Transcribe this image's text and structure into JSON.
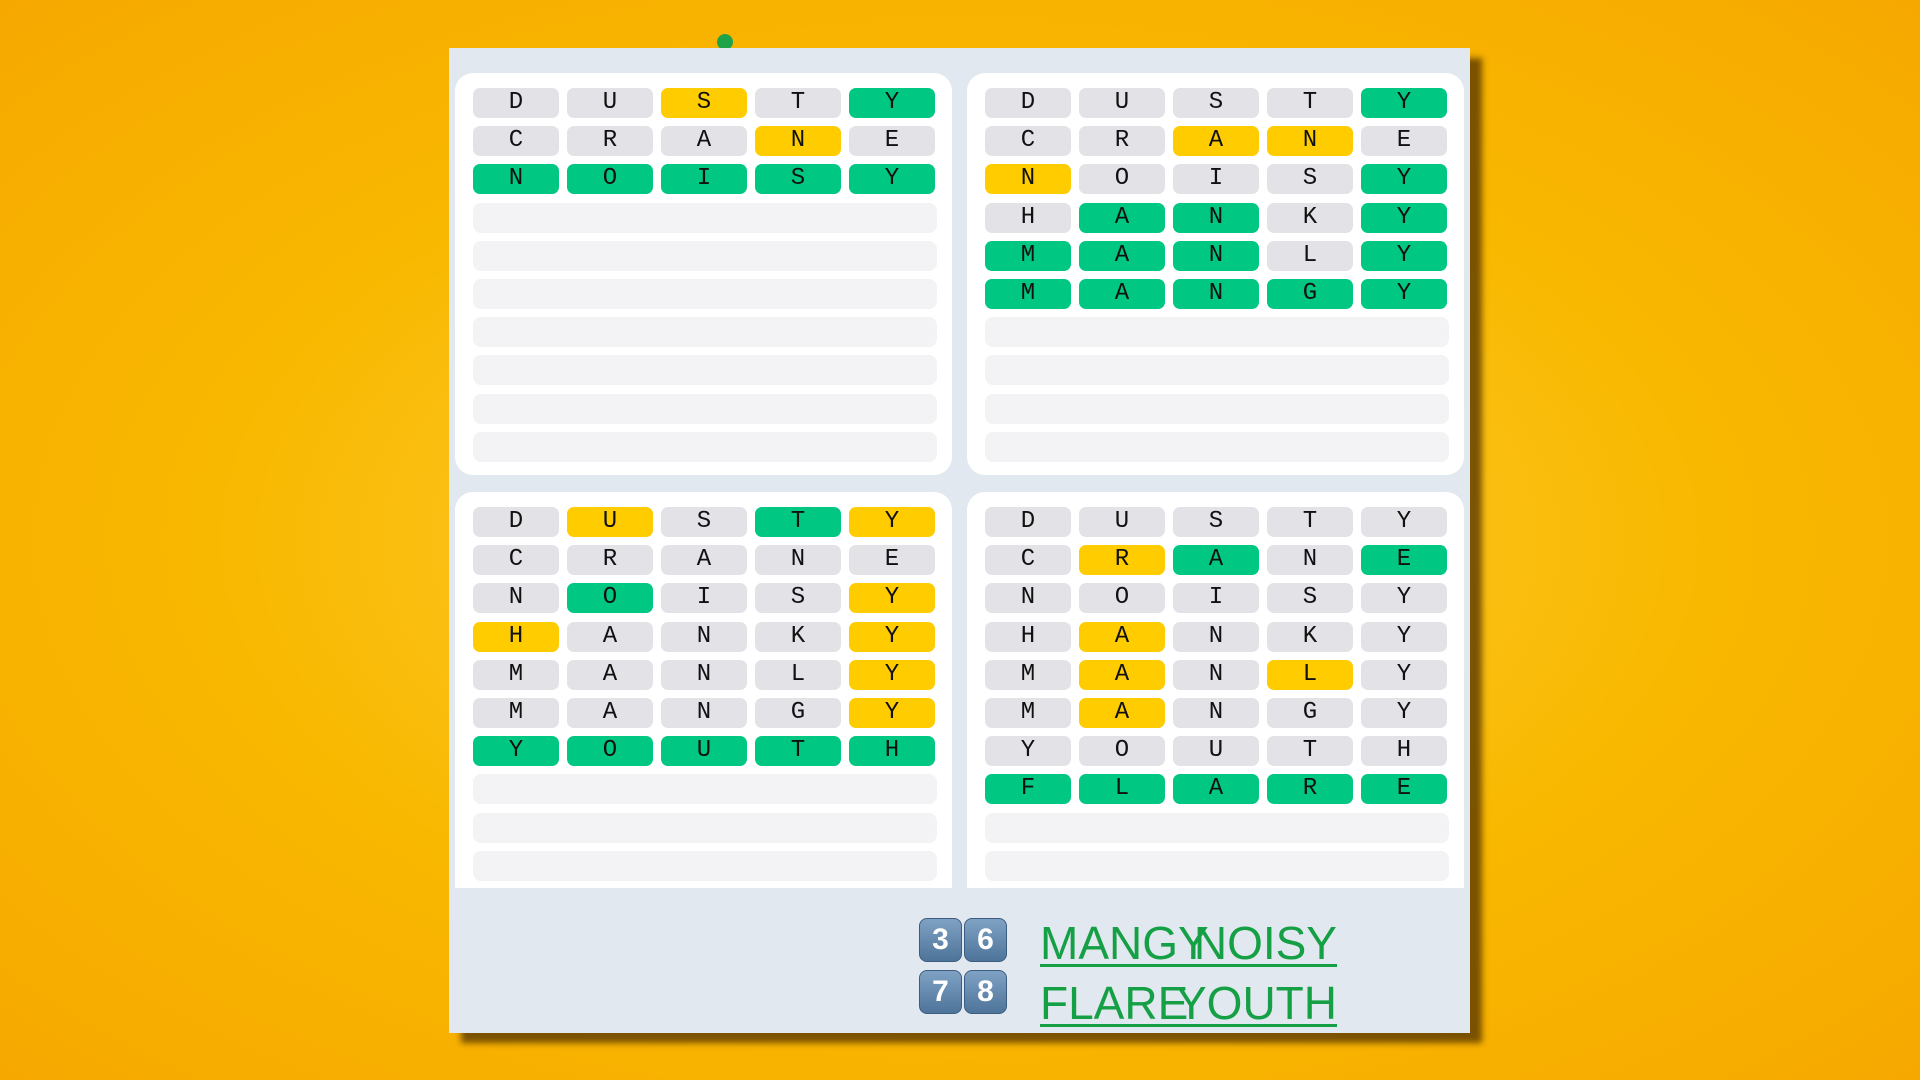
{
  "colors": {
    "correct": "#00c882",
    "present": "#ffcc00",
    "absent": "#e3e3e7",
    "answer": "#15a046"
  },
  "guesses": [
    "DUSTY",
    "CRANE",
    "NOISY",
    "HANKY",
    "MANLY",
    "MANGY",
    "YOUTH",
    "FLARE"
  ],
  "boards": [
    {
      "answer": "NOISY",
      "rows": [
        "xxyxg",
        "xxxyx",
        "ggggg"
      ]
    },
    {
      "answer": "MANGY",
      "rows": [
        "xxxxg",
        "xxyyx",
        "yxxxg",
        "xggxg",
        "gggxg",
        "ggggg"
      ]
    },
    {
      "answer": "YOUTH",
      "rows": [
        "xygy",
        "xxxxx",
        "xgxxy",
        "yxxxy",
        "xxxxy",
        "xxxxy",
        "ggggg"
      ]
    },
    {
      "answer": "FLARE",
      "rows": [
        "xxxxx",
        "xygxg",
        "xxxxx",
        "xyxxx",
        "xyxyx",
        "xyxxx",
        "xxxxx",
        "ggggg"
      ]
    }
  ],
  "footer": {
    "rows": [
      {
        "left": "NOISY",
        "keys": [
          "3",
          "6"
        ],
        "right": "MANGY"
      },
      {
        "left": "YOUTH",
        "keys": [
          "7",
          "8"
        ],
        "right": "FLARE"
      }
    ]
  }
}
